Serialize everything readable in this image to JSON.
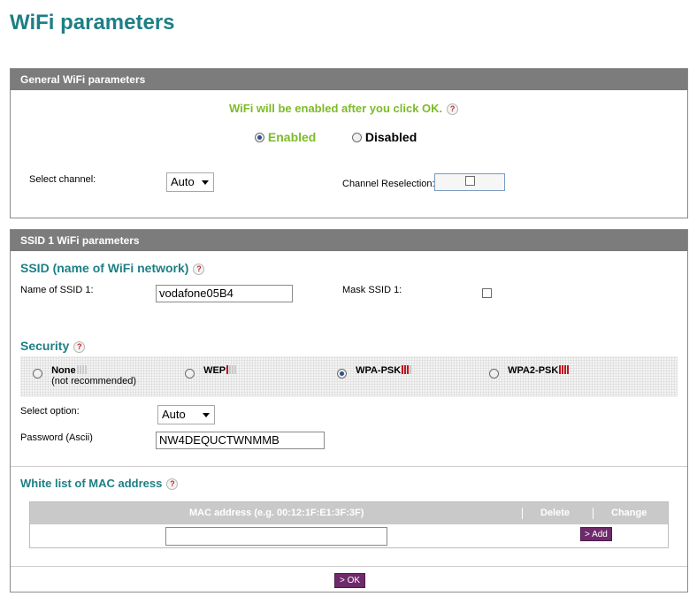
{
  "page": {
    "title": "WiFi parameters"
  },
  "general": {
    "header": "General WiFi parameters",
    "notice": "WiFi will be enabled after you click OK.",
    "enabled_label": "Enabled",
    "disabled_label": "Disabled",
    "enabled_checked": true,
    "channel_label": "Select channel:",
    "channel_value": "Auto",
    "reselection_label": "Channel Reselection:",
    "reselection_checked": false
  },
  "ssid1": {
    "header": "SSID 1 WiFi parameters",
    "ssid_title": "SSID (name of WiFi network)",
    "name_label": "Name of SSID 1:",
    "name_value": "vodafone05B4",
    "mask_label": "Mask SSID 1:",
    "mask_checked": false,
    "security_title": "Security",
    "security_options": [
      {
        "label": "None",
        "sublabel": "(not recommended)",
        "checked": false,
        "strength": 0
      },
      {
        "label": "WEP",
        "checked": false,
        "strength": 1
      },
      {
        "label": "WPA-PSK",
        "checked": true,
        "strength": 3
      },
      {
        "label": "WPA2-PSK",
        "checked": false,
        "strength": 4
      }
    ],
    "select_option_label": "Select option:",
    "select_option_value": "Auto",
    "password_label": "Password (Ascii)",
    "password_value": "NW4DEQUCTWNMMB",
    "whitelist_title": "White list of MAC address",
    "mac_table": {
      "col_mac": "MAC address (e.g. 00:12:1F:E1:3F:3F)",
      "col_delete": "Delete",
      "col_change": "Change",
      "mac_input_value": "",
      "add_label": "> Add"
    },
    "ok_label": "> OK"
  },
  "colors": {
    "accent": "#1d7f85",
    "green_text": "#7cbb29",
    "header_bg": "#7c7c7c",
    "button_bg": "#6e2a6b",
    "security_bar": "#c4121d"
  }
}
